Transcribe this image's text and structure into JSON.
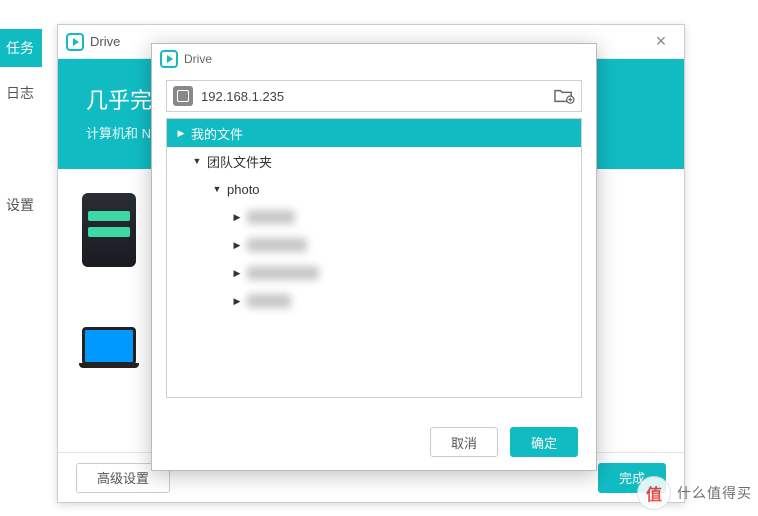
{
  "bgSidebar": {
    "tabActive": "任务",
    "tab1": "日志",
    "tab2": "设置"
  },
  "outerWindow": {
    "title": "Drive",
    "banner": {
      "heading": "几乎完成",
      "sub": "计算机和 N"
    },
    "footer": {
      "advanced": "高级设置",
      "done": "完成"
    }
  },
  "innerWindow": {
    "title": "Drive",
    "address": "192.168.1.235",
    "tree": {
      "myFiles": "我的文件",
      "teamFolder": "团队文件夹",
      "photo": "photo"
    },
    "footer": {
      "cancel": "取消",
      "ok": "确定"
    }
  },
  "watermark": {
    "logo": "值",
    "text": "什么值得买"
  }
}
